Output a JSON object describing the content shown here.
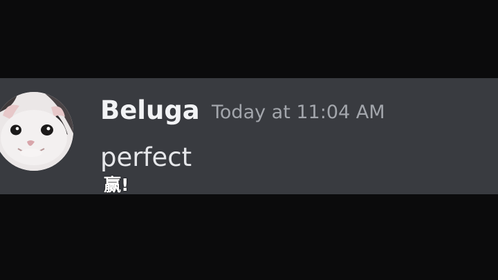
{
  "message": {
    "author": "Beluga",
    "timestamp": "Today at 11:04 AM",
    "text": "perfect"
  },
  "overlay": {
    "caption": "赢!"
  },
  "colors": {
    "background": "#0b0b0c",
    "message_background": "#393b40",
    "author": "#f2f3f5",
    "timestamp": "#a3a6ac",
    "text": "#e6e7ea"
  },
  "icons": {
    "avatar": "cat-avatar"
  }
}
